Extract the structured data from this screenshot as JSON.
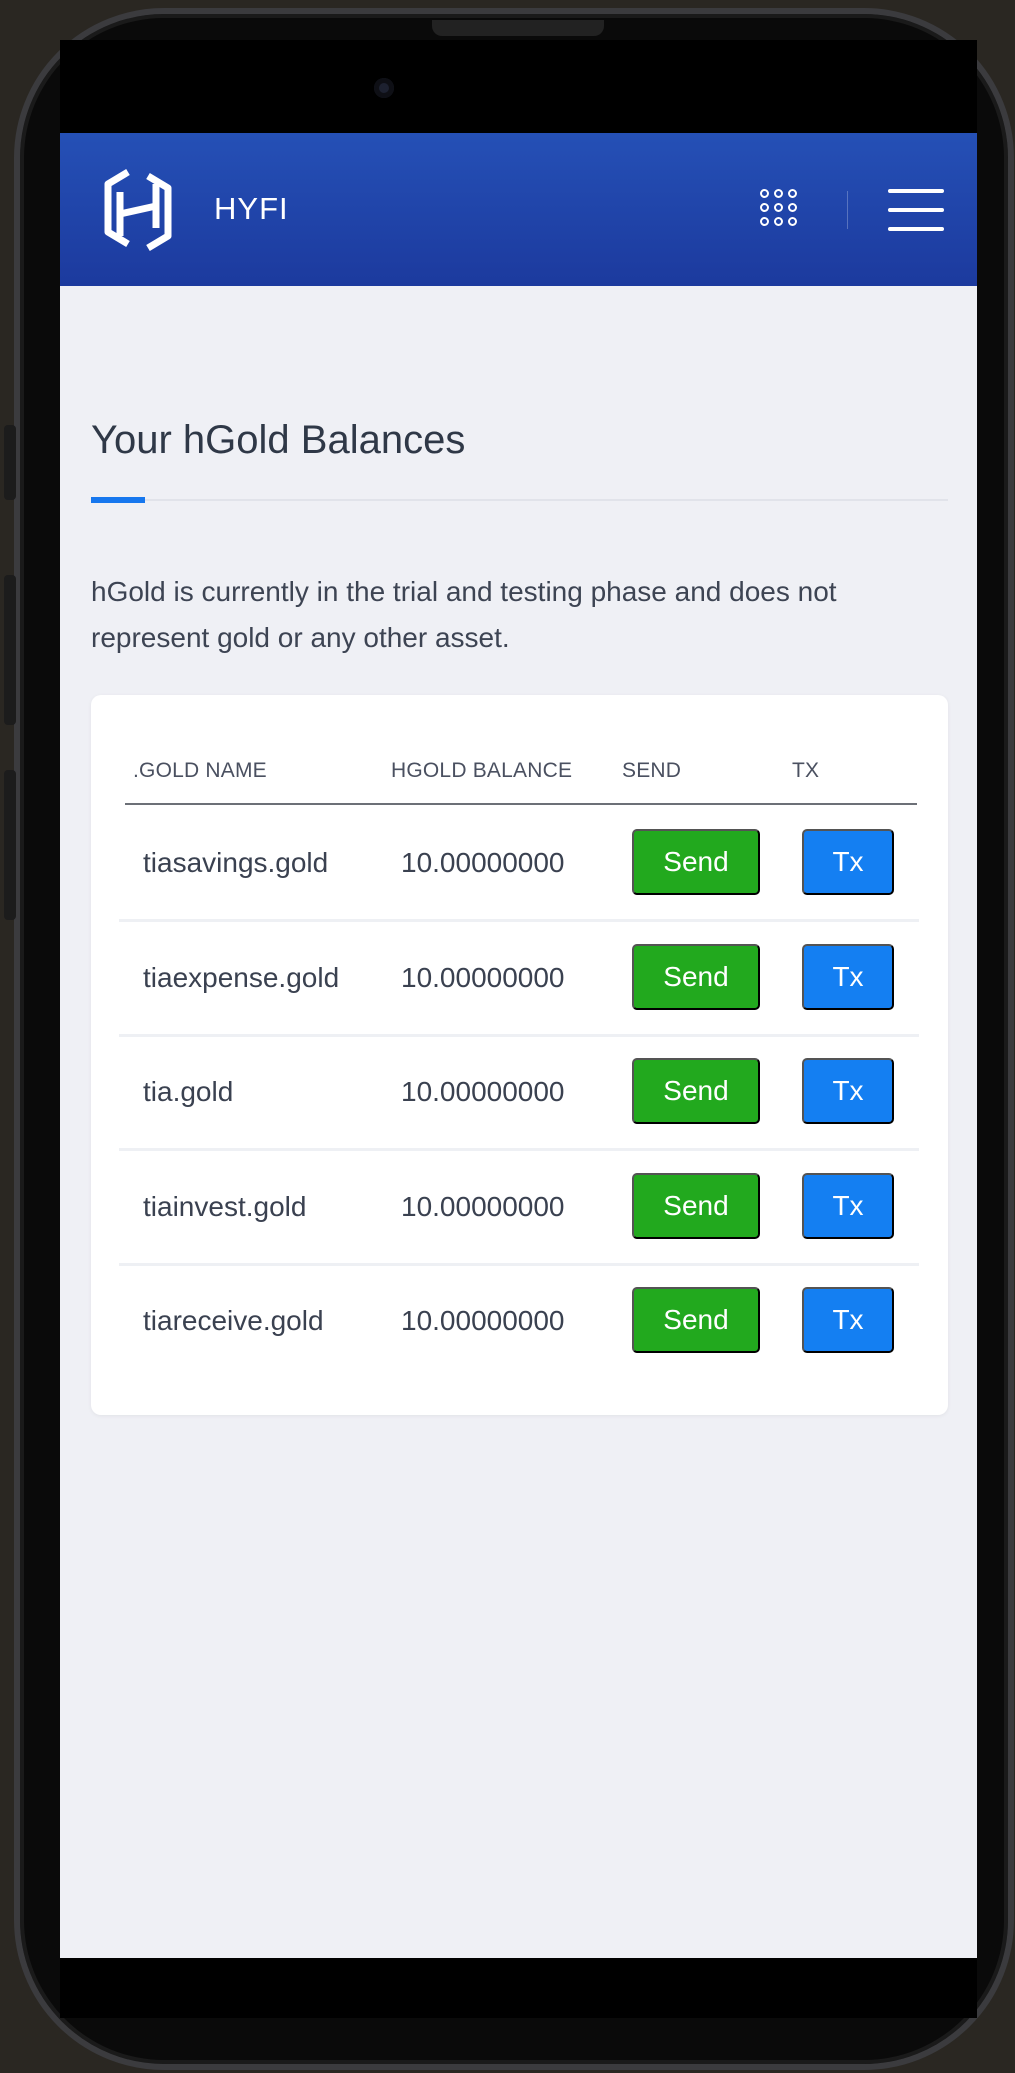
{
  "header": {
    "brand": "HYFI",
    "logo_icon": "hyfi-logo-icon",
    "apps_icon": "apps-grid-icon",
    "menu_icon": "hamburger-menu-icon",
    "bar_color": "#1f44a8"
  },
  "page": {
    "title": "Your hGold Balances",
    "accent_color": "#1677ee",
    "notice": "hGold is currently in the trial and testing phase and does not represent gold or any other asset."
  },
  "table": {
    "columns": [
      ".GOLD NAME",
      "HGOLD BALANCE",
      "SEND",
      "TX"
    ],
    "rows": [
      {
        "name": "tiasavings.gold",
        "balance": "10.00000000",
        "send_label": "Send",
        "tx_label": "Tx"
      },
      {
        "name": "tiaexpense.gold",
        "balance": "10.00000000",
        "send_label": "Send",
        "tx_label": "Tx"
      },
      {
        "name": "tia.gold",
        "balance": "10.00000000",
        "send_label": "Send",
        "tx_label": "Tx"
      },
      {
        "name": "tiainvest.gold",
        "balance": "10.00000000",
        "send_label": "Send",
        "tx_label": "Tx"
      },
      {
        "name": "tiareceive.gold",
        "balance": "10.00000000",
        "send_label": "Send",
        "tx_label": "Tx"
      }
    ],
    "send_color": "#22a91e",
    "tx_color": "#147ff2"
  }
}
